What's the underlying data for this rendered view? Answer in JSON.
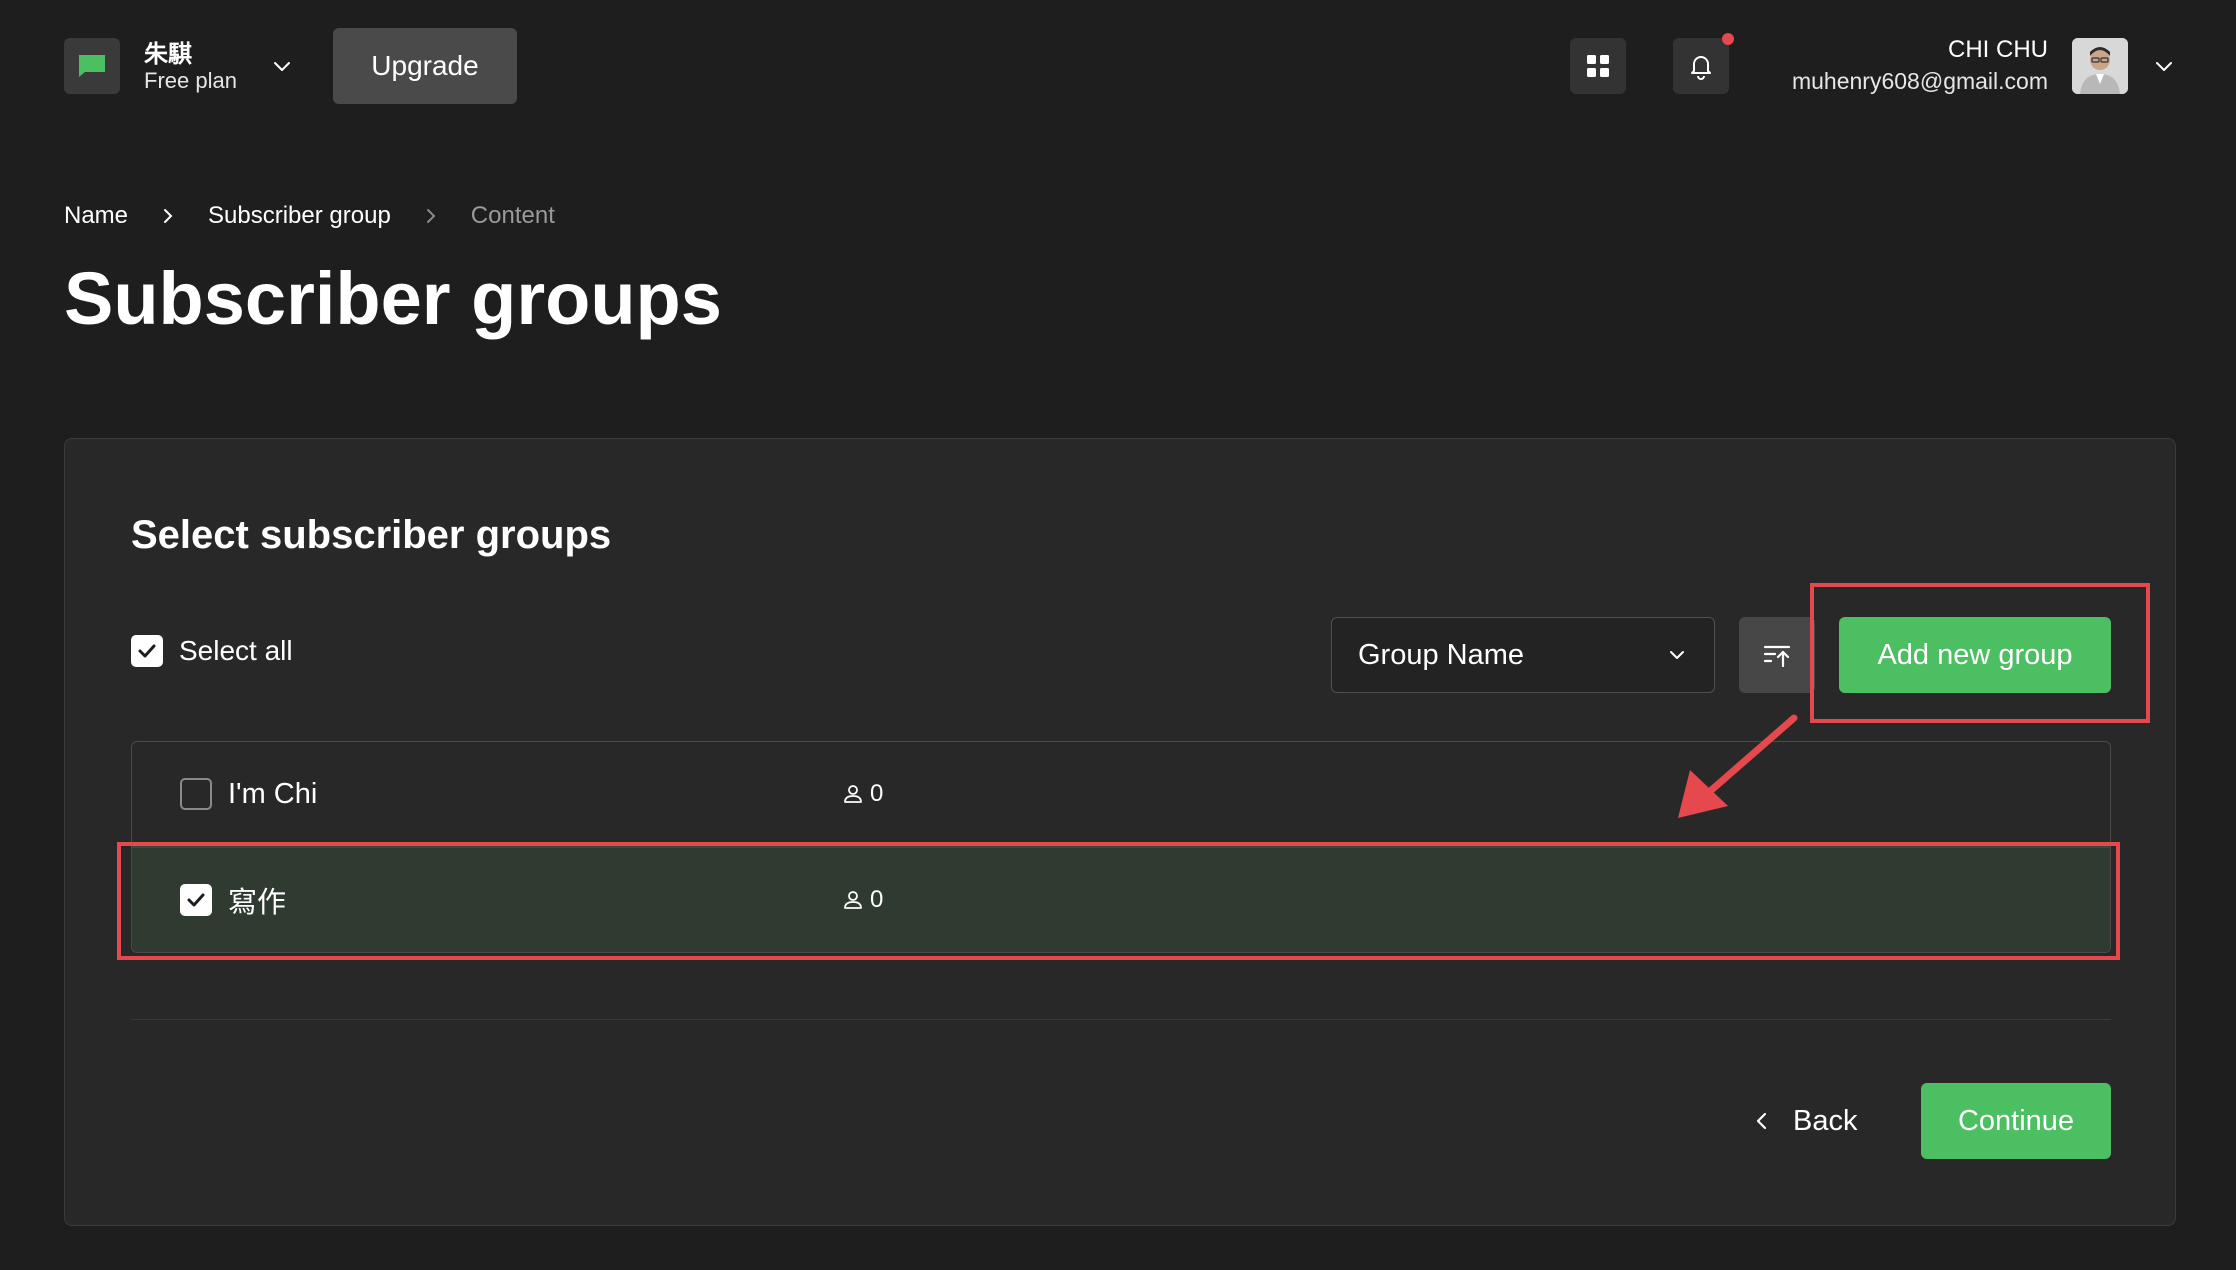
{
  "header": {
    "workspace_name": "朱騏",
    "plan": "Free plan",
    "upgrade_label": "Upgrade",
    "user_name": "CHI CHU",
    "user_email": "muhenry608@gmail.com",
    "notification_dot_color": "#e5484d"
  },
  "breadcrumb": {
    "items": [
      "Name",
      "Subscriber group",
      "Content"
    ],
    "current_index": 2
  },
  "page_title": "Subscriber groups",
  "card": {
    "title": "Select subscriber groups",
    "select_all_label": "Select all",
    "select_all_checked": true,
    "sort_by": "Group Name",
    "add_group_label": "Add new group",
    "groups": [
      {
        "name": "I'm Chi",
        "count": "0",
        "checked": false
      },
      {
        "name": "寫作",
        "count": "0",
        "checked": true
      }
    ],
    "back_label": "Back",
    "continue_label": "Continue"
  },
  "colors": {
    "background": "#1e1e1e",
    "card": "#282828",
    "accent_green": "#4cbf63",
    "annotation_red": "#e5484d",
    "selected_row": "#2f3a31"
  },
  "icons": [
    "chat-icon",
    "chevron-down-icon",
    "apps-grid-icon",
    "bell-icon",
    "chevron-right-icon",
    "sort-order-icon",
    "user-icon",
    "chevron-left-icon",
    "check-icon"
  ]
}
